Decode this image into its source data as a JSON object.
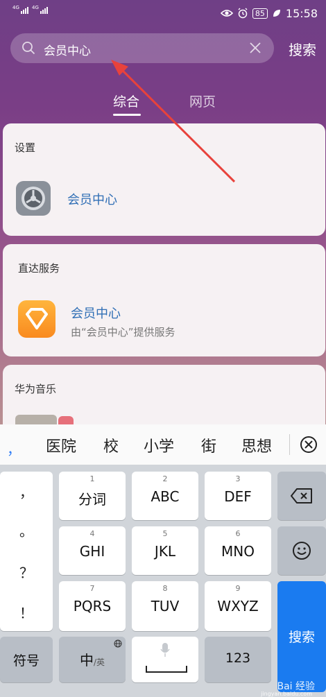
{
  "status_bar": {
    "sim1_label": "4G",
    "sim2_label": "4G",
    "battery": "85",
    "time": "15:58",
    "icons": [
      "eye-icon",
      "alarm-icon",
      "battery-icon",
      "leaf-icon"
    ]
  },
  "search": {
    "query": "会员中心",
    "button_label": "搜索"
  },
  "tabs": [
    {
      "label": "综合",
      "active": true
    },
    {
      "label": "网页",
      "active": false
    }
  ],
  "settings_card": {
    "title": "设置",
    "app_name": "会员中心"
  },
  "service_card": {
    "title": "直达服务",
    "app_name": "会员中心",
    "subtitle": "由“会员中心”提供服务"
  },
  "music_card": {
    "title": "华为音乐"
  },
  "candidates": {
    "comma": "，",
    "words": [
      "医院",
      "校",
      "小学",
      "街",
      "思想"
    ]
  },
  "keyboard": {
    "punct": [
      "，",
      "。",
      "？",
      "！"
    ],
    "keys": [
      {
        "num": "1",
        "label": "分词"
      },
      {
        "num": "2",
        "label": "ABC"
      },
      {
        "num": "3",
        "label": "DEF"
      },
      {
        "num": "4",
        "label": "GHI"
      },
      {
        "num": "5",
        "label": "JKL"
      },
      {
        "num": "6",
        "label": "MNO"
      },
      {
        "num": "7",
        "label": "PQRS"
      },
      {
        "num": "8",
        "label": "TUV"
      },
      {
        "num": "9",
        "label": "WXYZ"
      }
    ],
    "symbol_key": "符号",
    "lang_main": "中",
    "lang_sub": "/英",
    "num_key": "123",
    "enter_label": "搜索"
  },
  "watermark": {
    "brand": "Bai 经验",
    "url": "jingyan.baidu.com"
  },
  "colors": {
    "accent_blue": "#2f6eb5",
    "enter_blue": "#1a7bf0",
    "arrow_red": "#e8423c"
  }
}
